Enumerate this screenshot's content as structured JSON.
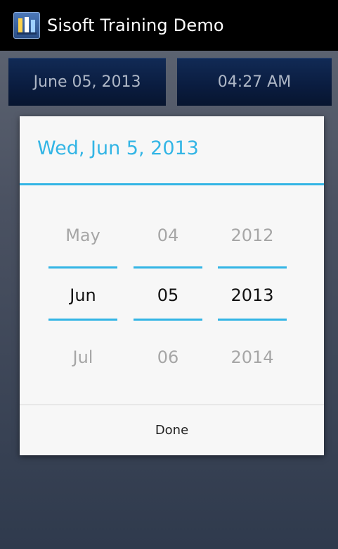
{
  "app": {
    "title": "Sisoft Training Demo",
    "icon": "sisoft-logo-icon"
  },
  "main": {
    "date_button": "June 05, 2013",
    "time_button": "04:27 AM"
  },
  "dialog": {
    "title": "Wed, Jun 5, 2013",
    "month": {
      "prev": "May",
      "current": "Jun",
      "next": "Jul"
    },
    "day": {
      "prev": "04",
      "current": "05",
      "next": "06"
    },
    "year": {
      "prev": "2012",
      "current": "2013",
      "next": "2014"
    },
    "done_label": "Done"
  },
  "colors": {
    "accent": "#33b5e5",
    "actionbar": "#000000",
    "button_bg": "#0a1c3f"
  }
}
